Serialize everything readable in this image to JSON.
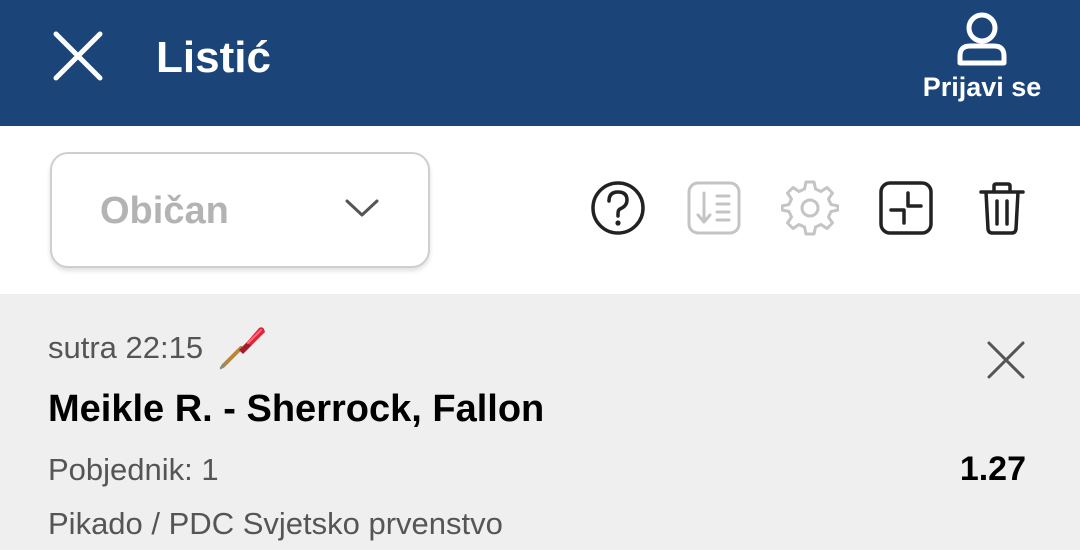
{
  "header": {
    "title": "Listić",
    "login_label": "Prijavi se",
    "close_icon": "close-icon",
    "user_icon": "user-icon",
    "background": "#1b4479"
  },
  "toolbar": {
    "ticket_type": {
      "selected": "Običan",
      "icon": "chevron-down-icon"
    },
    "icons": [
      {
        "name": "help-icon",
        "enabled": true
      },
      {
        "name": "sort-icon",
        "enabled": false
      },
      {
        "name": "settings-icon",
        "enabled": false
      },
      {
        "name": "collapse-icon",
        "enabled": true
      },
      {
        "name": "trash-icon",
        "enabled": true
      }
    ]
  },
  "bet": {
    "time": "sutra 22:15",
    "sport_icon": "darts-icon",
    "match": "Meikle R. - Sherrock, Fallon",
    "market": "Pobjednik: 1",
    "odds": "1.27",
    "league": "Pikado / PDC Svjetsko prvenstvo",
    "remove_icon": "close-icon"
  }
}
